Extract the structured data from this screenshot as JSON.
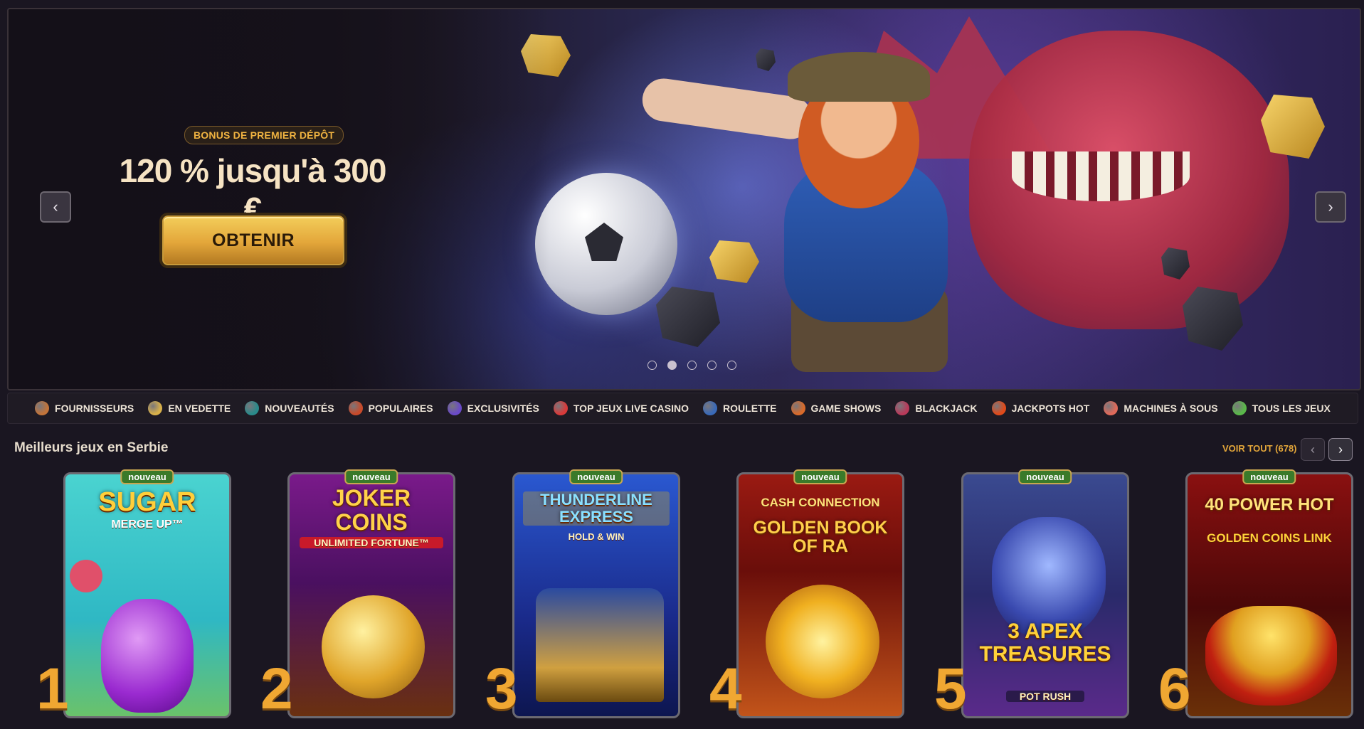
{
  "hero": {
    "bonus_tag": "BONUS DE PREMIER DÉPÔT",
    "headline": "120 % jusqu'à 300 €",
    "cta_label": "OBTENIR",
    "prev_glyph": "‹",
    "next_glyph": "›",
    "slides_total": 5,
    "active_slide": 2
  },
  "categories": [
    {
      "label": "FOURNISSEURS",
      "icon": "providers-icon",
      "color": "#c2743a"
    },
    {
      "label": "EN VEDETTE",
      "icon": "star-icon",
      "color": "#d8b04a"
    },
    {
      "label": "NOUVEAUTÉS",
      "icon": "gem-icon",
      "color": "#2a8a8a"
    },
    {
      "label": "POPULAIRES",
      "icon": "fire-icon",
      "color": "#c84a2a"
    },
    {
      "label": "EXCLUSIVITÉS",
      "icon": "crystal-icon",
      "color": "#6a4ac8"
    },
    {
      "label": "TOP JEUX LIVE CASINO",
      "icon": "live-chip-icon",
      "color": "#d83a3a"
    },
    {
      "label": "ROULETTE",
      "icon": "roulette-icon",
      "color": "#3a6ab8"
    },
    {
      "label": "GAME SHOWS",
      "icon": "wheel-icon",
      "color": "#d86a2a"
    },
    {
      "label": "BLACKJACK",
      "icon": "cards-icon",
      "color": "#b83a5a"
    },
    {
      "label": "JACKPOTS HOT",
      "icon": "hot-icon",
      "color": "#e04a1a"
    },
    {
      "label": "MACHINES À SOUS",
      "icon": "slot-machine-icon",
      "color": "#e06a5a"
    },
    {
      "label": "TOUS LES JEUX",
      "icon": "all-games-icon",
      "color": "#5ab84a"
    }
  ],
  "top_games": {
    "title": "Meilleurs jeux en Serbie",
    "see_all": "VOIR TOUT (678)",
    "prev_glyph": "‹",
    "next_glyph": "›",
    "games": [
      {
        "rank": "1",
        "badge": "nouveau",
        "title": "SUGAR",
        "subtitle": "MERGE UP™"
      },
      {
        "rank": "2",
        "badge": "nouveau",
        "title": "JOKER COINS",
        "subtitle": "UNLIMITED FORTUNE™"
      },
      {
        "rank": "3",
        "badge": "nouveau",
        "title": "THUNDERLINE EXPRESS",
        "subtitle": "HOLD & WIN"
      },
      {
        "rank": "4",
        "badge": "nouveau",
        "title": "GOLDEN BOOK OF RA",
        "subtitle": "CASH CONNECTION"
      },
      {
        "rank": "5",
        "badge": "nouveau",
        "title": "3 APEX TREASURES",
        "subtitle": "POT RUSH"
      },
      {
        "rank": "6",
        "badge": "nouveau",
        "title": "40 POWER HOT",
        "subtitle": "GOLDEN COINS LINK"
      }
    ]
  }
}
